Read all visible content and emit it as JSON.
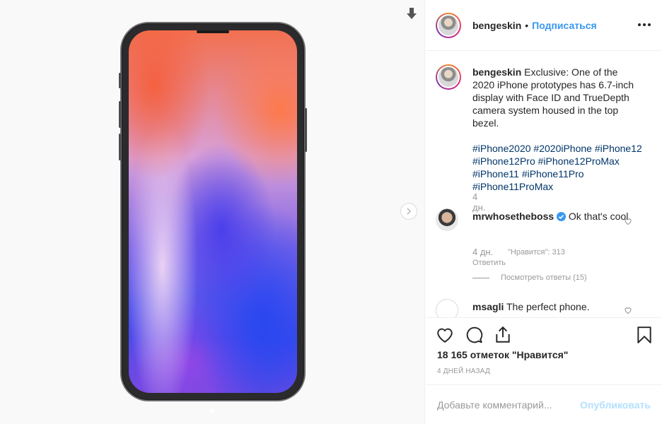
{
  "post": {
    "author": "bengeskin",
    "separator": "•",
    "follow_label": "Подписаться"
  },
  "caption": {
    "author": "bengeskin",
    "text": "Exclusive: One of the 2020 iPhone prototypes has 6.7-inch display with Face ID and TrueDepth camera system housed in the top bezel.",
    "hashtags": [
      "#iPhone2020",
      "#2020iPhone",
      "#iPhone12",
      "#iPhone12Pro",
      "#iPhone12ProMax",
      "#iPhone11",
      "#iPhone11Pro",
      "#iPhone11ProMax"
    ],
    "time": "4 дн."
  },
  "comments": [
    {
      "author": "mrwhosetheboss",
      "verified": true,
      "text": "Ok that's cool",
      "time": "4 дн.",
      "likes": "\"Нравится\": 313",
      "reply_label": "Ответить",
      "view_replies": "Посмотреть ответы (15)"
    },
    {
      "author": "msagli",
      "text": "The perfect phone."
    }
  ],
  "footer": {
    "likes_count": "18 165 отметок \"Нравится\"",
    "time_ago": "4 ДНЕЙ НАЗАД",
    "comment_placeholder": "Добавьте комментарий...",
    "publish_label": "Опубликовать"
  },
  "colors": {
    "link": "#3897f0",
    "hashtag": "#003569",
    "publish_disabled": "#b2dffc"
  }
}
